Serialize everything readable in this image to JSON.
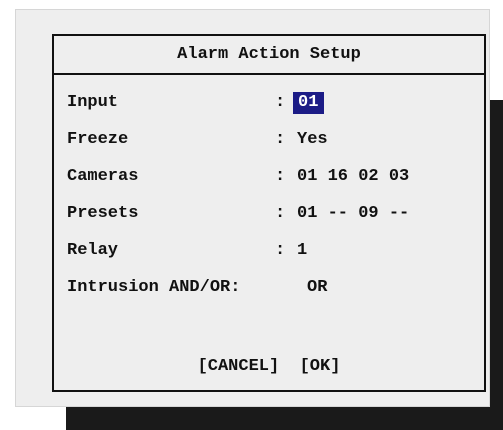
{
  "dialog": {
    "title": "Alarm Action Setup",
    "separator": ":",
    "fields": [
      {
        "label": "Input",
        "value": "01"
      },
      {
        "label": "Freeze",
        "value": "Yes"
      },
      {
        "label": "Cameras",
        "value": "01 16 02 03"
      },
      {
        "label": "Presets",
        "value": "01 -- 09 --"
      },
      {
        "label": "Relay",
        "value": "1"
      },
      {
        "label": "Intrusion AND/OR:",
        "value": "OR"
      }
    ],
    "buttons": {
      "cancel": "[CANCEL]",
      "ok": "[OK]"
    }
  },
  "colors": {
    "panel": "#eeeeee",
    "shadow": "#1a1a1a",
    "highlight": "#1b1b86",
    "text": "#111111"
  }
}
